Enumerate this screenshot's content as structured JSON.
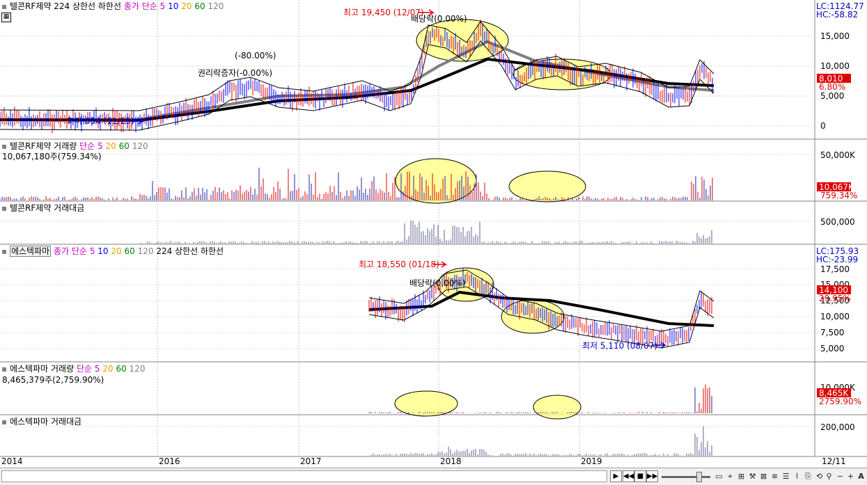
{
  "panels": {
    "p1": {
      "title": "텔콘RF제약",
      "legend": [
        "224",
        "상한선",
        "하한선"
      ],
      "ma_label": "종가 단순",
      "ma_periods": [
        "5",
        "10",
        "20",
        "60",
        "120"
      ],
      "lc": "LC:1124.77",
      "hc": "HC:-58.82",
      "yticks": [
        "15,000",
        "10,000",
        "5,000",
        "0"
      ],
      "current_price": "8,010",
      "current_pct": "6.80%",
      "high_note": "최고 19,450 (12/07)",
      "low_note": "최저 654 (11/25)",
      "dividend_note": "배당락(0.00%)",
      "rights_note": "권리락증자(-0.00%)",
      "rights_note2": "(-80.00%)"
    },
    "p2": {
      "title": "텔콘RF제약 거래량",
      "ma_label": "단순",
      "ma_periods": [
        "5",
        "20",
        "60",
        "120"
      ],
      "volume": "10,067,180주(759.34%)",
      "ytick": "50,000K",
      "current": "10,067K",
      "current_pct": "759.34%"
    },
    "p3": {
      "title": "텔콘RF제약 거래대금",
      "ytick": "500,000"
    },
    "p4": {
      "title": "에스텍파마",
      "ma_label": "종가 단순",
      "ma_periods": [
        "5",
        "10",
        "20",
        "60",
        "120"
      ],
      "legend": [
        "224",
        "상한선",
        "하한선"
      ],
      "lc": "LC:175.93",
      "hc": "HC:-23.99",
      "yticks": [
        "17,500",
        "15,000",
        "12,500",
        "10,000",
        "7,500",
        "5,000"
      ],
      "current_price": "14,100",
      "current_pct": "29.95%",
      "high_note": "최고 18,550 (01/18)",
      "low_note": "최저 5,110 (08/07)",
      "dividend_note": "배당락(0.00%)"
    },
    "p5": {
      "title": "에스텍파마 거래량",
      "ma_label": "단순",
      "ma_periods": [
        "5",
        "20",
        "60",
        "120"
      ],
      "volume": "8,465,379주(2,759.90%)",
      "ytick": "10,000K",
      "current": "8,465K",
      "current_pct": "2759.90%"
    },
    "p6": {
      "title": "에스텍파마 거래대금",
      "ytick": "200,000"
    }
  },
  "xaxis": {
    "labels": [
      "2014",
      "2016",
      "2017",
      "2018",
      "2019"
    ],
    "date": "12/11"
  },
  "colors": {
    "ma5": "#0000ff",
    "ma10": "#0000ff",
    "ma20": "#e0a000",
    "ma60": "#008000",
    "ma120": "#808080",
    "ma224": "#000000",
    "price_badge": "#e00000",
    "highlight": "#ffff80",
    "volume": "#606090"
  },
  "toolbar": {
    "icons": [
      "scroll-left-icon",
      "first-icon",
      "prev-icon",
      "stop-icon",
      "next-icon",
      "zoom-out-icon",
      "zoom-in-icon",
      "font-icon"
    ]
  }
}
